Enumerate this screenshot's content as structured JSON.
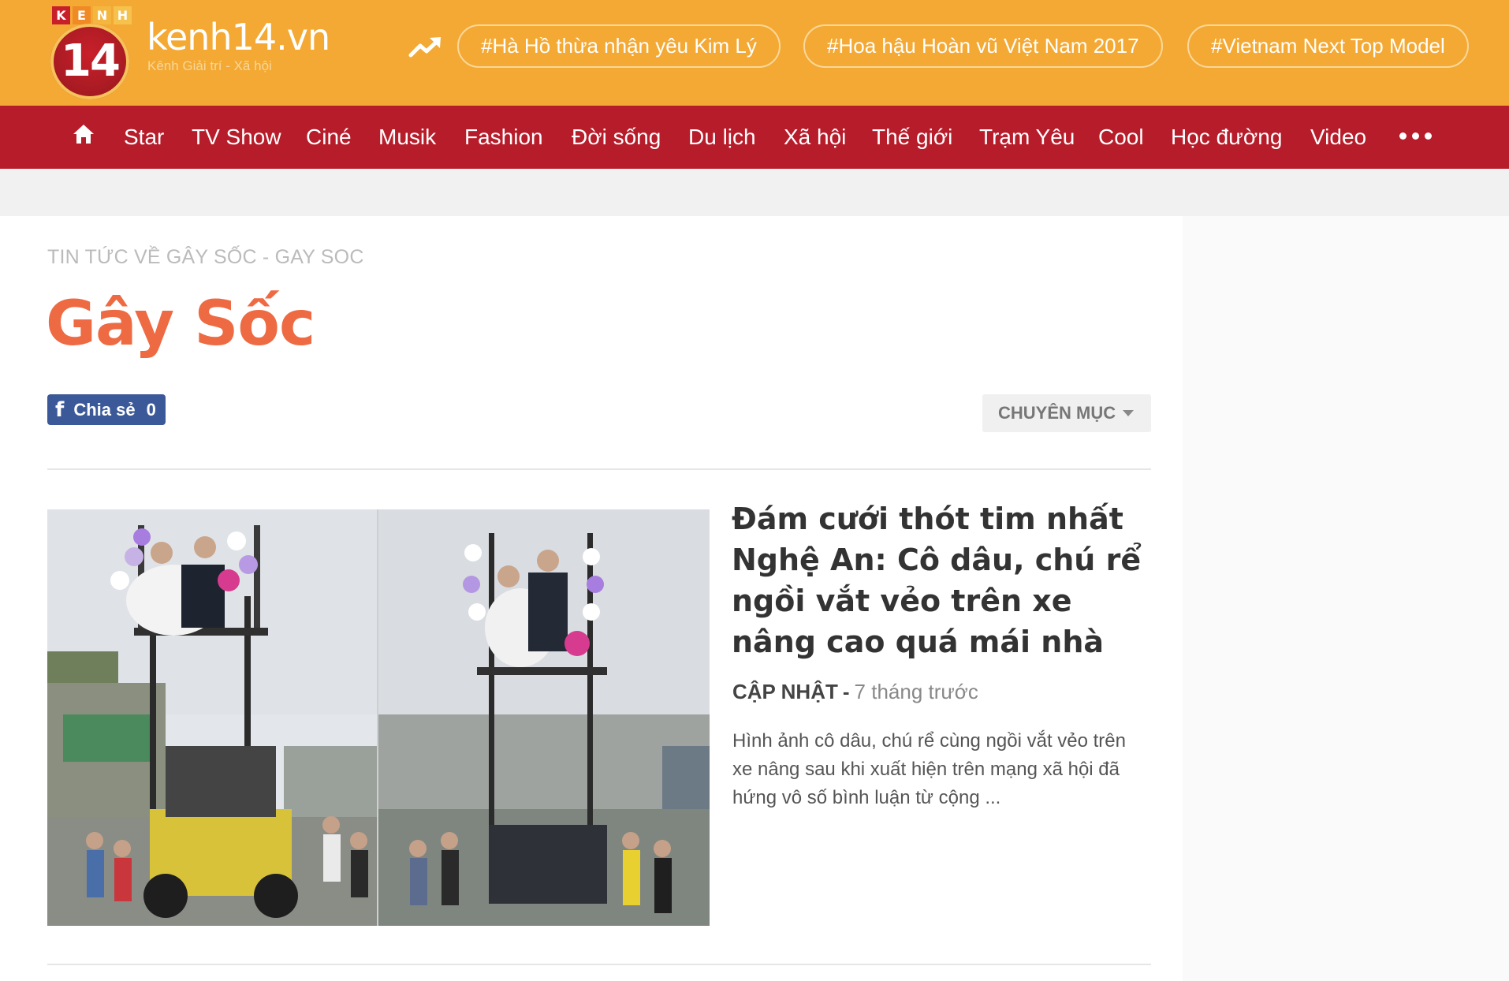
{
  "header": {
    "logo_letters": [
      "K",
      "E",
      "N",
      "H"
    ],
    "logo_number": "14",
    "site_name": "kenh14.vn",
    "tagline": "Kênh Giải trí - Xã hội",
    "trending_tags": [
      "#Hà Hồ thừa nhận yêu Kim Lý",
      "#Hoa hậu Hoàn vũ Việt Nam 2017",
      "#Vietnam Next Top Model"
    ]
  },
  "nav": {
    "items": [
      "Star",
      "TV Show",
      "Ciné",
      "Musik",
      "Fashion",
      "Đời sống",
      "Du lịch",
      "Xã hội",
      "Thế giới",
      "Trạm Yêu",
      "Cool",
      "Học đường",
      "Video"
    ]
  },
  "page": {
    "breadcrumb": "TIN TỨC VỀ GÂY SỐC - GAY SOC",
    "title": "Gây Sốc",
    "share": {
      "icon": "f",
      "label": "Chia sẻ",
      "count": "0"
    },
    "category_button": "CHUYÊN MỤC"
  },
  "article": {
    "title": "Đám cưới thót tim nhất Nghệ An: Cô dâu, chú rể ngồi vắt vẻo trên xe nâng cao quá mái nhà",
    "category": "CẬP NHẬT",
    "separator": "-",
    "time": "7 tháng trước",
    "excerpt": "Hình ảnh cô dâu, chú rể cùng ngồi vắt vẻo trên xe nâng sau khi xuất hiện trên mạng xã hội đã hứng vô số bình luận từ cộng ..."
  },
  "colors": {
    "topbar": "#f3a934",
    "nav": "#b71c2a",
    "title_accent": "#ee6a43",
    "facebook": "#3b5998"
  }
}
